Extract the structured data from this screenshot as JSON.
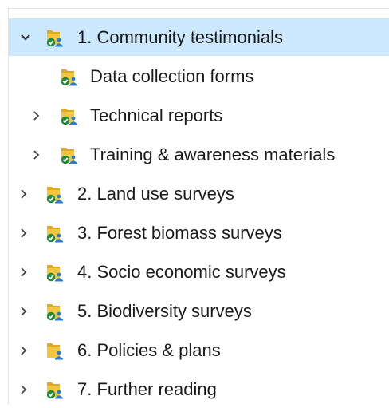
{
  "tree": {
    "items": [
      {
        "label": "1. Community testimonials",
        "icon": "shared-folder-synced-icon",
        "expanded": true,
        "selected": true,
        "has_children": true
      },
      {
        "label": "Data collection forms",
        "icon": "shared-folder-synced-icon",
        "expanded": false,
        "selected": false,
        "has_children": false
      },
      {
        "label": "Technical reports",
        "icon": "shared-folder-synced-icon",
        "expanded": false,
        "selected": false,
        "has_children": true
      },
      {
        "label": "Training & awareness materials",
        "icon": "shared-folder-synced-icon",
        "expanded": false,
        "selected": false,
        "has_children": true
      },
      {
        "label": "2. Land use surveys",
        "icon": "shared-folder-synced-icon",
        "expanded": false,
        "selected": false,
        "has_children": true
      },
      {
        "label": "3. Forest biomass surveys",
        "icon": "shared-folder-synced-icon",
        "expanded": false,
        "selected": false,
        "has_children": true
      },
      {
        "label": "4. Socio economic surveys",
        "icon": "shared-folder-synced-icon",
        "expanded": false,
        "selected": false,
        "has_children": true
      },
      {
        "label": "5. Biodiversity surveys",
        "icon": "shared-folder-synced-icon",
        "expanded": false,
        "selected": false,
        "has_children": true
      },
      {
        "label": "6. Policies & plans",
        "icon": "shared-folder-icon",
        "expanded": false,
        "selected": false,
        "has_children": true
      },
      {
        "label": "7. Further reading",
        "icon": "shared-folder-synced-icon",
        "expanded": false,
        "selected": false,
        "has_children": true
      }
    ]
  },
  "colors": {
    "selection": "#cce8ff",
    "folder": "#f3c640",
    "folder_back": "#e2a91f",
    "sync_check": "#1f8a3a",
    "share_person": "#2b7cd3",
    "chevron": "#444444"
  }
}
